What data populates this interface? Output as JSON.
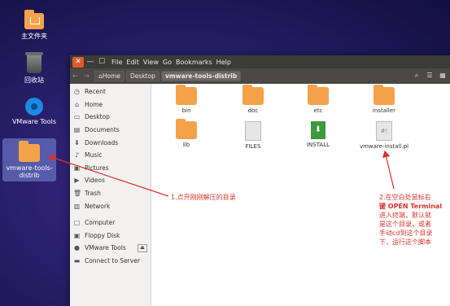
{
  "desktop": {
    "icons": [
      {
        "label": "主文件夹",
        "icon": "home-folder-icon"
      },
      {
        "label": "回收站",
        "icon": "trash-icon"
      },
      {
        "label": "VMware Tools",
        "icon": "vmware-disc-icon"
      },
      {
        "label": "vmware-tools-distrib",
        "icon": "folder-icon"
      }
    ]
  },
  "window": {
    "close": "✕",
    "minimize": "—",
    "maximize": "☐",
    "menu": [
      "File",
      "Edit",
      "View",
      "Go",
      "Bookmarks",
      "Help"
    ],
    "breadcrumb": [
      "Home",
      "Desktop",
      "vmware-tools-distrib"
    ],
    "sidebar": [
      {
        "label": "Recent",
        "icon": "clock-icon"
      },
      {
        "label": "Home",
        "icon": "home-icon"
      },
      {
        "label": "Desktop",
        "icon": "desktop-icon"
      },
      {
        "label": "Documents",
        "icon": "document-icon"
      },
      {
        "label": "Downloads",
        "icon": "download-icon"
      },
      {
        "label": "Music",
        "icon": "music-icon"
      },
      {
        "label": "Pictures",
        "icon": "picture-icon"
      },
      {
        "label": "Videos",
        "icon": "video-icon"
      },
      {
        "label": "Trash",
        "icon": "trash-icon"
      },
      {
        "label": "Network",
        "icon": "network-icon"
      },
      {
        "label": "Computer",
        "icon": "computer-icon"
      },
      {
        "label": "Floppy Disk",
        "icon": "floppy-icon"
      },
      {
        "label": "VMware Tools",
        "icon": "disc-icon"
      },
      {
        "label": "Connect to Server",
        "icon": "server-icon"
      }
    ],
    "files": [
      {
        "name": "bin",
        "type": "folder"
      },
      {
        "name": "doc",
        "type": "folder"
      },
      {
        "name": "etc",
        "type": "folder"
      },
      {
        "name": "installer",
        "type": "folder"
      },
      {
        "name": "lib",
        "type": "folder"
      },
      {
        "name": "FILES",
        "type": "file"
      },
      {
        "name": "INSTALL",
        "type": "install"
      },
      {
        "name": "vmware-install.pl",
        "type": "script"
      }
    ]
  },
  "annotations": {
    "note1": "1.点开刚刚解压的目录",
    "note2_line1": "2.在空白处鼠标右",
    "note2_line2": "键 OPEN Terminal",
    "note2_line3": "进入终端，默认就",
    "note2_line4": "是这个目录，或者",
    "note2_line5": "手动cd到这个目录",
    "note2_line6": "下，运行这个脚本"
  }
}
